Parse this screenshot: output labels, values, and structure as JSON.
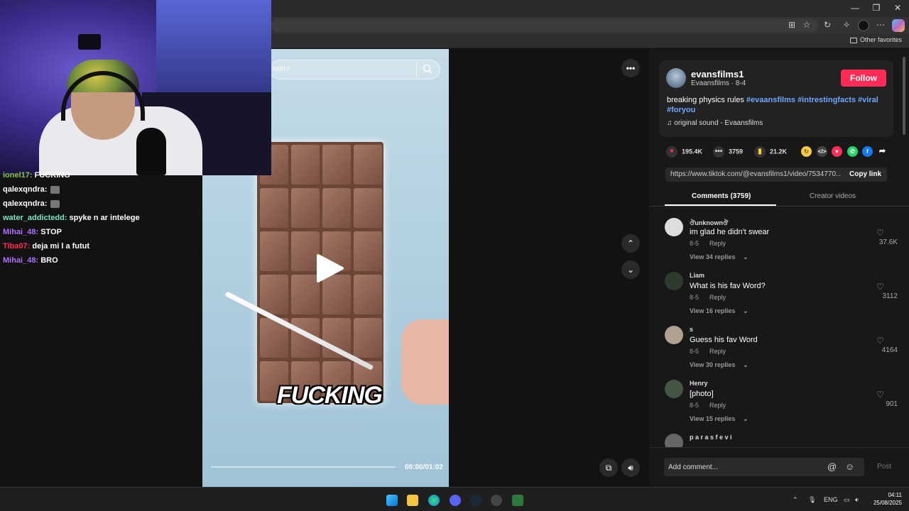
{
  "browser": {
    "other_favorites": "Other favorites"
  },
  "chat": {
    "lines": [
      {
        "user": "ionel17",
        "message": "FUCKING",
        "color": "#8bc34a"
      },
      {
        "user": "qalexqndra",
        "message": "",
        "color": "#ffffff"
      },
      {
        "user": "qalexqndra",
        "message": "",
        "color": "#ffffff"
      },
      {
        "user": "water_addictedd",
        "message": "spyke n ar intelege",
        "color": "#7fe3c4"
      },
      {
        "user": "Mihai_48",
        "message": "STOP",
        "color": "#b070ff"
      },
      {
        "user": "Tiba07",
        "message": "deja mi l a futut",
        "color": "#ff2d55"
      },
      {
        "user": "Mihai_48",
        "message": "BRO",
        "color": "#b070ff"
      }
    ]
  },
  "video": {
    "search_placeholder": "ntent",
    "caption": "FUCKING",
    "time": "00:00/01:02",
    "progress": 0.0
  },
  "post": {
    "author": "evansfilms1",
    "author_sub": "Evaansfilms · 8-4",
    "follow_label": "Follow",
    "description_text": "breaking physics rules ",
    "hashtags": [
      "#evaansfilms",
      "#intrestingfacts",
      "#viral",
      "#foryou"
    ],
    "sound": "original sound - Evaansfilms",
    "likes": "195.4K",
    "comments": "3759",
    "saves": "21.2K",
    "link": "https://www.tiktok.com/@evansfilms1/video/7534770...",
    "copy_link": "Copy link",
    "tab_comments": "Comments (3759)",
    "tab_creator": "Creator videos"
  },
  "comments": [
    {
      "name": "ঔunknownঔ",
      "text": "im glad he didn't swear",
      "date": "8-5",
      "reply": "Reply",
      "view": "View 34 replies",
      "likes": "37.6K"
    },
    {
      "name": "Liam",
      "text": "What is his fav Word?",
      "date": "8-5",
      "reply": "Reply",
      "view": "View 16 replies",
      "likes": "3112"
    },
    {
      "name": "s",
      "text": "Guess his fav Word",
      "date": "8-5",
      "reply": "Reply",
      "view": "View 30 replies",
      "likes": "4164"
    },
    {
      "name": "Henry",
      "text": "[photo]",
      "date": "8-5",
      "reply": "Reply",
      "view": "View 15 replies",
      "likes": "901"
    },
    {
      "name": "p a r a s f e v i",
      "text": "",
      "date": "",
      "reply": "",
      "view": "",
      "likes": ""
    }
  ],
  "composer": {
    "placeholder": "Add comment...",
    "post_label": "Post"
  },
  "taskbar": {
    "lang": "ENG",
    "time": "04:11",
    "date": "25/08/2025"
  },
  "colors": {
    "accent": "#fe2c55",
    "hashtag": "#6fa7ff",
    "background": "#121212"
  }
}
